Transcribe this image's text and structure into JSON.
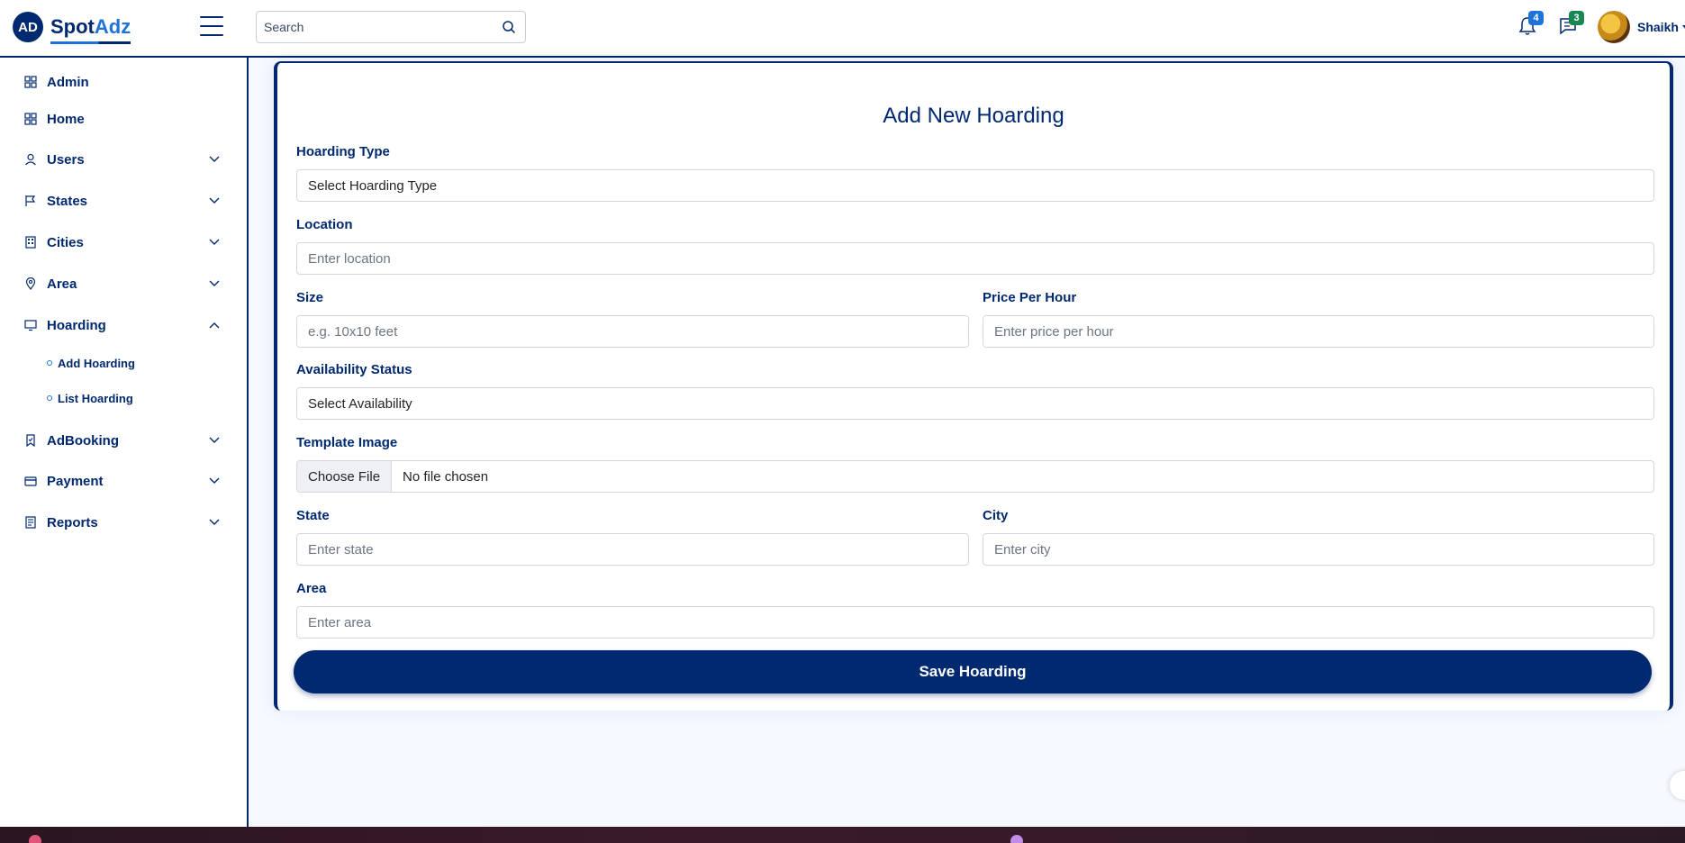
{
  "header": {
    "logo_badge": "AD",
    "logo_spot": "Spot",
    "logo_adz": "Adz",
    "search_placeholder": "Search",
    "notifications_count": "4",
    "messages_count": "3",
    "user_name": "Shaikh"
  },
  "sidebar": {
    "items": [
      {
        "label": "Admin",
        "icon": "grid-icon"
      },
      {
        "label": "Home",
        "icon": "grid-icon"
      },
      {
        "label": "Users",
        "icon": "person-icon"
      },
      {
        "label": "States",
        "icon": "flag-icon"
      },
      {
        "label": "Cities",
        "icon": "building-icon"
      },
      {
        "label": "Area",
        "icon": "location-pin-icon"
      },
      {
        "label": "Hoarding",
        "icon": "display-icon"
      },
      {
        "label": "AdBooking",
        "icon": "bookmark-icon"
      },
      {
        "label": "Payment",
        "icon": "credit-card-icon"
      },
      {
        "label": "Reports",
        "icon": "report-icon"
      }
    ],
    "hoarding_sub": [
      {
        "label": "Add Hoarding"
      },
      {
        "label": "List Hoarding"
      }
    ]
  },
  "form": {
    "title": "Add New Hoarding",
    "hoarding_type_label": "Hoarding Type",
    "hoarding_type_value": "Select Hoarding Type",
    "location_label": "Location",
    "location_placeholder": "Enter location",
    "size_label": "Size",
    "size_placeholder": "e.g. 10x10 feet",
    "price_label": "Price Per Hour",
    "price_placeholder": "Enter price per hour",
    "availability_label": "Availability Status",
    "availability_value": "Select Availability",
    "template_label": "Template Image",
    "choose_file": "Choose File",
    "no_file": "No file chosen",
    "state_label": "State",
    "state_placeholder": "Enter state",
    "city_label": "City",
    "city_placeholder": "Enter city",
    "area_label": "Area",
    "area_placeholder": "Enter area",
    "save_button": "Save Hoarding"
  },
  "colors": {
    "primary": "#012970",
    "accent": "#1e73d8",
    "badge_green": "#198754"
  }
}
